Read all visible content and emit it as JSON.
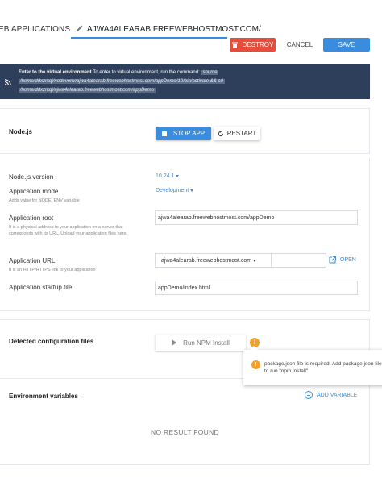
{
  "header": {
    "crumb_root": "EB APPLICATIONS",
    "crumb_icon": "pencil-icon",
    "crumb_current": "AJWA4ALEARAB.FREEWEBHOSTMOST.COM/",
    "destroy_label": "DESTROY",
    "cancel_label": "CANCEL",
    "save_label": "SAVE"
  },
  "banner": {
    "icon": "rss-icon",
    "lead": "Enter to the virtual environment.",
    "text": "To enter to virtual environment, run the command:",
    "cmd1": "source",
    "cmd2": "/home/ddxzrkqj/nodevenv/ajwa4alearab.freewebhostmost.com/appDemo/10/bin/activate && cd",
    "cmd3": "/home/ddxzrkqj/ajwa4alearab.freewebhostmost.com/appDemo"
  },
  "nodejs": {
    "title": "Node.js",
    "stop_label": "STOP APP",
    "restart_label": "RESTART"
  },
  "form": {
    "version_label": "Node.js version",
    "version_value": "10.24.1",
    "mode_label": "Application mode",
    "mode_hint": "Adds value for NODE_ENV variable",
    "mode_value": "Development",
    "root_label": "Application root",
    "root_hint": "It is a physical address to your application on a server that corresponds with its URL. Upload your application files here.",
    "root_value": "ajwa4alearab.freewebhostmost.com/appDemo",
    "url_label": "Application URL",
    "url_hint": "It is an HTTP/HTTPS link to your application",
    "url_domain": "ajwa4alearab.freewebhostmost.com",
    "url_path": "",
    "open_label": "OPEN",
    "startup_label": "Application startup file",
    "startup_value": "appDemo/index.html"
  },
  "config": {
    "title": "Detected configuration files",
    "npm_label": "Run NPM Install",
    "warn_glyph": "!",
    "tooltip": "package.json file is required. Add package.json file to run \"npm install\""
  },
  "env": {
    "title": "Environment variables",
    "add_label": "ADD VARIABLE",
    "empty_label": "NO RESULT FOUND"
  },
  "colors": {
    "accent": "#3a8dde",
    "danger": "#e74c3c",
    "banner": "#2e3f5c",
    "warning": "#f0a030"
  }
}
